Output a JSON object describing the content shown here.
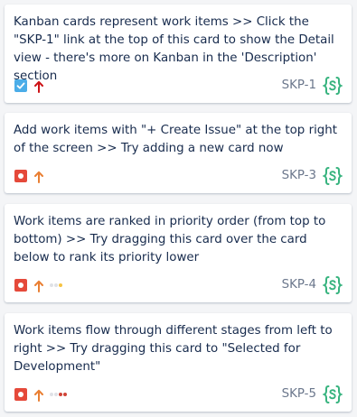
{
  "colors": {
    "background": "#f4f5f7",
    "card_background": "#ffffff",
    "text": "#172b4d",
    "key_text": "#6b778c",
    "task_type": "#4bade8",
    "bug_type": "#e5493a",
    "priority_highest": "#cd1317",
    "priority_high": "#e97f33",
    "component_green": "#36b37e",
    "estimate_grey": "#dfe1e6",
    "estimate_yellow": "#f6c342",
    "estimate_red": "#d04437"
  },
  "cards": [
    {
      "summary": "Kanban cards represent work items >> Click the \"SKP-1\" link at the top of this card to show the Detail view - there's more on Kanban in the 'Description' section",
      "key": "SKP-1",
      "type_icon": "task-checkbox-icon",
      "priority_icon": "priority-highest-arrow-icon",
      "component_icon": "code-braces-icon",
      "estimate_dots": []
    },
    {
      "summary": "Add work items with \"+ Create Issue\" at the top right of the screen >> Try adding a new card now",
      "key": "SKP-3",
      "type_icon": "bug-icon",
      "priority_icon": "priority-high-arrow-icon",
      "component_icon": "code-braces-icon",
      "estimate_dots": []
    },
    {
      "summary": "Work items are ranked in priority order (from top to bottom) >> Try dragging this card over the card below to rank its priority lower",
      "key": "SKP-4",
      "type_icon": "bug-icon",
      "priority_icon": "priority-high-arrow-icon",
      "component_icon": "code-braces-icon",
      "estimate_dots": [
        "#dfe1e6",
        "#dfe1e6",
        "#f6c342"
      ]
    },
    {
      "summary": "Work items flow through different stages from left to right >> Try dragging this card to \"Selected for Development\"",
      "key": "SKP-5",
      "type_icon": "bug-icon",
      "priority_icon": "priority-high-arrow-icon",
      "component_icon": "code-braces-icon",
      "estimate_dots": [
        "#dfe1e6",
        "#dfe1e6",
        "#d04437",
        "#d04437"
      ]
    }
  ]
}
